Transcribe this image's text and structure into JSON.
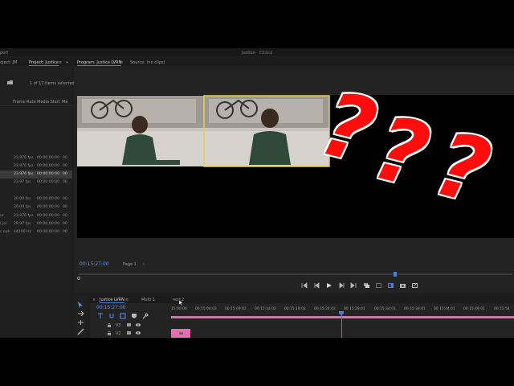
{
  "app": {
    "left_cut_title": "port",
    "title": "Justice",
    "title_sep": "-",
    "title_status": "Edited"
  },
  "project": {
    "tab_prev": "oject: JM",
    "tab_active": "Project: Justice",
    "menu": "≡",
    "more": "»",
    "items_selected": "1 of 17 items selected",
    "columns": [
      "Frame Rate",
      "Media Start",
      "Me"
    ],
    "rows": [
      {
        "name": "",
        "rate": "23.976 fps",
        "start": "00:00:00:00",
        "extra": "00"
      },
      {
        "name": "",
        "rate": "23.976 fps",
        "start": "00:00:00:00",
        "extra": "00"
      },
      {
        "name": "",
        "rate": "23.976 fps",
        "start": "00:00:00:00",
        "extra": "00"
      },
      {
        "name": "",
        "rate": "23.97 fps",
        "start": "00:00:00:00",
        "extra": "00"
      },
      {
        "name": "",
        "rate": "30.00 fps",
        "start": "00:00:00:00",
        "extra": "00"
      },
      {
        "name": "",
        "rate": "30.00 fps",
        "start": "00:00:00:00",
        "extra": "00"
      },
      {
        "name": "ur",
        "rate": "23.976 fps",
        "start": "00:00:00:00",
        "extra": "00"
      },
      {
        "name": "l.jor",
        "rate": "29.97 fps",
        "start": "00:00:00:00",
        "extra": "00"
      },
      {
        "name": "c eph",
        "rate": "44100 Hz",
        "start": "00:00:00:00",
        "extra": "00"
      }
    ]
  },
  "program": {
    "tab_active": "Program: Justice LVRN",
    "menu": "≡",
    "tab_source": "Source: (no clips)",
    "timecode": "00:15:27:00",
    "page": "Page 1",
    "page_caret": "›",
    "playhead_pct": 0.73
  },
  "overlay": {
    "question_marks": [
      "?",
      "?",
      "?"
    ]
  },
  "timeline": {
    "tabs": [
      "Justice LVRN",
      "Multi 1",
      "rest 2"
    ],
    "menu": "≡",
    "close": "×",
    "timecode": "00:15:27:00",
    "ruler": [
      "15:00:00",
      "00:15:04:02",
      "00:15:09:02",
      "00:15:14:02",
      "00:15:19:02",
      "00:15:24:02",
      "00:15:29:01",
      "00:15:34:01",
      "00:15:39:01",
      "00:15:44:01",
      "00:15:49:01",
      "00:15:54"
    ],
    "tracks": [
      {
        "lock": "🔒",
        "name": "V3"
      },
      {
        "lock": "🔒",
        "name": "V2"
      }
    ]
  },
  "colors": {
    "accent_blue": "#4a7ed6",
    "selection_yellow": "#e8d33a",
    "clip_pink": "#e86ab3",
    "question_red": "#ff0d0d"
  }
}
